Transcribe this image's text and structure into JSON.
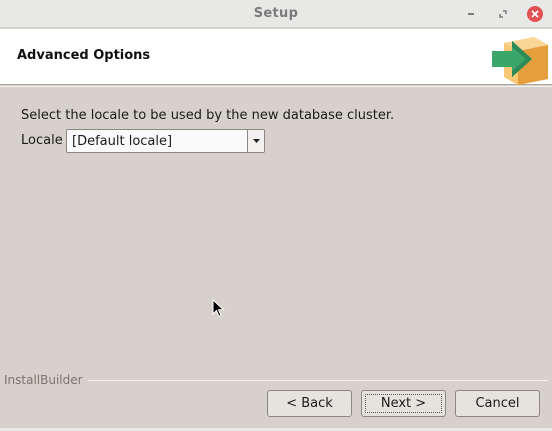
{
  "window": {
    "title": "Setup"
  },
  "header": {
    "title": "Advanced Options"
  },
  "content": {
    "instruction": "Select the locale to be used by the new database cluster.",
    "locale_label": "Locale",
    "locale_value": "[Default locale]"
  },
  "footer": {
    "brand": "InstallBuilder",
    "back_label": "< Back",
    "next_label": "Next >",
    "cancel_label": "Cancel"
  },
  "colors": {
    "close_button": "#e25252",
    "window_bg": "#d6d2cb",
    "logo_box": "#f2b65a",
    "logo_arrow": "#3aa66a"
  }
}
